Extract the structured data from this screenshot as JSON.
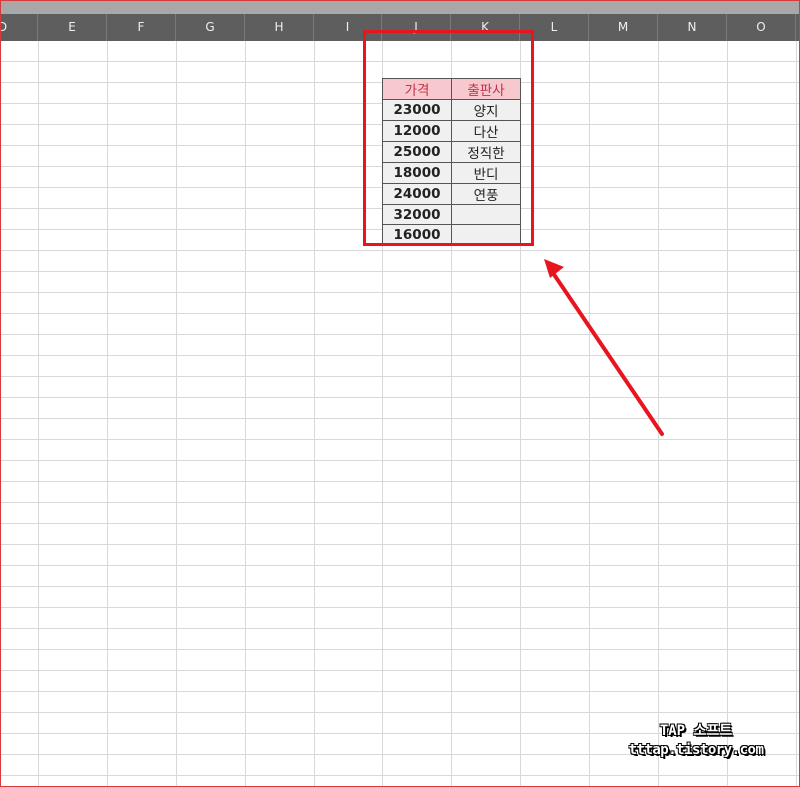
{
  "columns": [
    "D",
    "E",
    "F",
    "G",
    "H",
    "I",
    "J",
    "K",
    "L",
    "M",
    "N",
    "O"
  ],
  "table": {
    "headers": [
      "가격",
      "출판사"
    ],
    "rows": [
      [
        "23000",
        "양지"
      ],
      [
        "12000",
        "다산"
      ],
      [
        "25000",
        "정직한"
      ],
      [
        "18000",
        "반디"
      ],
      [
        "24000",
        "연풍"
      ],
      [
        "32000",
        ""
      ],
      [
        "16000",
        ""
      ]
    ]
  },
  "watermark": {
    "line1": "TAP 소프트",
    "line2": "tttap.tistory.com"
  },
  "colors": {
    "header_bg": "#5e5e5e",
    "table_header_bg": "#f8c8cf",
    "table_header_text": "#c4324a",
    "highlight": "#e8141e"
  }
}
